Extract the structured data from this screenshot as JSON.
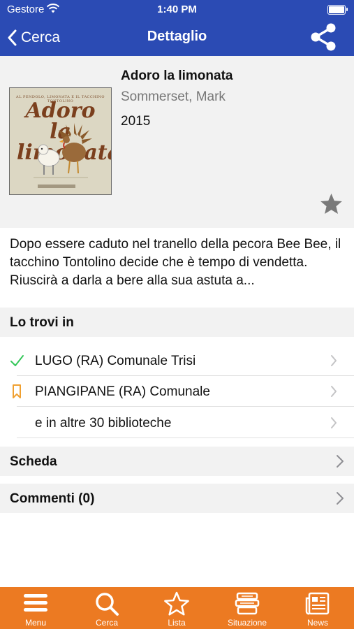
{
  "status_bar": {
    "carrier": "Gestore",
    "time": "1:40 PM"
  },
  "nav": {
    "back_label": "Cerca",
    "title": "Dettaglio"
  },
  "book": {
    "title": "Adoro la limonata",
    "author": "Sommerset, Mark",
    "year": "2015",
    "cover_top_text": "AL PENDOLO, LIMONATA E IL TACCHINO TONTOLINO",
    "cover_title": "Adoro la limonata"
  },
  "description": "Dopo essere caduto nel tranello della pecora Bee Bee, il tacchino Tontolino decide che è tempo di vendetta. Riuscirà a darla a bere alla sua astuta a...",
  "availability": {
    "header": "Lo trovi in",
    "rows": [
      {
        "label": "LUGO (RA) Comunale Trisi",
        "icon": "checkmark-icon"
      },
      {
        "label": "PIANGIPANE (RA) Comunale",
        "icon": "bookmark-icon"
      },
      {
        "label": "e in altre 30 biblioteche",
        "icon": ""
      }
    ]
  },
  "sections": {
    "scheda": "Scheda",
    "commenti": "Commenti (0)"
  },
  "tabs": [
    {
      "label": "Menu",
      "icon": "hamburger-icon"
    },
    {
      "label": "Cerca",
      "icon": "search-icon"
    },
    {
      "label": "Lista",
      "icon": "star-icon"
    },
    {
      "label": "Situazione",
      "icon": "books-icon"
    },
    {
      "label": "News",
      "icon": "newspaper-icon"
    }
  ],
  "colors": {
    "nav_blue": "#2b4bb4",
    "tab_orange": "#ec7a22",
    "check_green": "#34c759",
    "bookmark_orange": "#f0a030"
  }
}
